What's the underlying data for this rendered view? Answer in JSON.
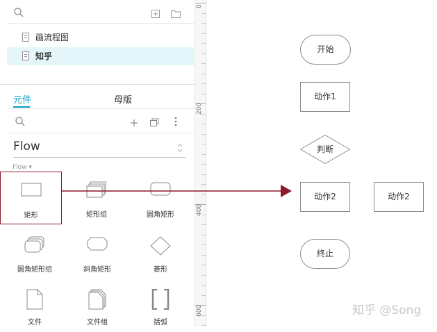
{
  "pages": {
    "items": [
      {
        "label": "画流程图"
      },
      {
        "label": "知乎"
      }
    ]
  },
  "tabs": {
    "widgets": "元件",
    "masters": "母版"
  },
  "library": {
    "selected": "Flow",
    "section_label": "Flow ▾",
    "items": [
      {
        "label": "矩形"
      },
      {
        "label": "矩形组"
      },
      {
        "label": "圆角矩形"
      },
      {
        "label": "圆角矩形组"
      },
      {
        "label": "斜角矩形"
      },
      {
        "label": "菱形"
      },
      {
        "label": "文件"
      },
      {
        "label": "文件组"
      },
      {
        "label": "括弧"
      }
    ]
  },
  "ruler": {
    "labels": [
      "0",
      "200",
      "400",
      "600"
    ]
  },
  "canvas": {
    "start": "开始",
    "action1": "动作1",
    "decision": "判断",
    "action2": "动作2",
    "action2_copy": "动作2",
    "end": "终止"
  },
  "watermark": "知乎 @Song",
  "colors": {
    "selected_row": "#e4f6f9",
    "tab_accent": "#00a0c8",
    "highlight_border": "#8b1a2b",
    "arrow": "#8b1a2b",
    "node_border": "#8c8c8c"
  }
}
